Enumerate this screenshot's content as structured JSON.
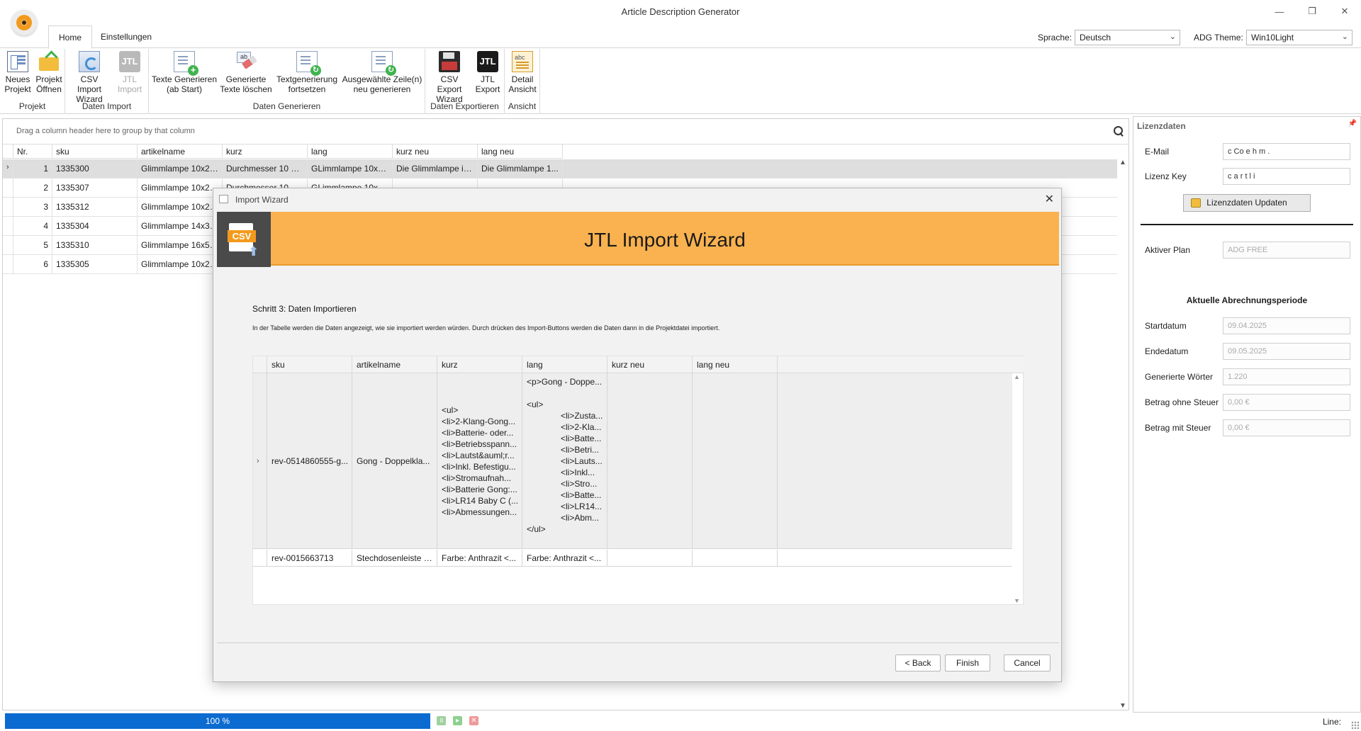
{
  "window": {
    "title": "Article Description Generator",
    "minimize": "—",
    "maximize": "❐",
    "close": "✕"
  },
  "ribbon_tabs": [
    "Home",
    "Einstellungen"
  ],
  "language": {
    "label": "Sprache:",
    "value": "Deutsch"
  },
  "theme": {
    "label": "ADG Theme:",
    "value": "Win10Light"
  },
  "ribbon": {
    "groups": {
      "projekt": "Projekt",
      "daten_import": "Daten Import",
      "daten_generieren": "Daten Generieren",
      "daten_exportieren": "Daten Exportieren",
      "ansicht": "Ansicht"
    },
    "buttons": {
      "neues_projekt": "Neues\nProjekt",
      "projekt_oeffnen": "Projekt\nÖffnen",
      "csv_import_wizard": "CSV Import\nWizard",
      "jtl_import": "JTL\nImport",
      "texte_generieren": "Texte Generieren\n(ab Start)",
      "generierte_texte_loeschen": "Generierte\nTexte löschen",
      "textgenerierung_fortsetzen": "Textgenerierung\nfortsetzen",
      "ausgewaehlte_neu_generieren": "Ausgewählte Zeile(n)\nneu generieren",
      "csv_export_wizard": "CSV Export\nWizard",
      "jtl_export": "JTL\nExport",
      "detail_ansicht": "Detail\nAnsicht"
    },
    "jtl_glyph": "JTL"
  },
  "grid": {
    "group_hint": "Drag a column header here to group by that column",
    "columns": [
      "Nr.",
      "sku",
      "artikelname",
      "kurz",
      "lang",
      "kurz neu",
      "lang neu"
    ],
    "rows": [
      {
        "nr": "1",
        "sku": "1335300",
        "artikelname": "Glimmlampe 10x25...",
        "kurz": "Durchmesser 10 m...",
        "lang": "GLimmlampe 10x2...",
        "kurz_neu": "Die Glimmlampe in...",
        "lang_neu": "Die Glimmlampe 1..."
      },
      {
        "nr": "2",
        "sku": "1335307",
        "artikelname": "Glimmlampe 10x28...",
        "kurz": "Durchmesser 10 m...",
        "lang": "GLimmlampe 10x2...",
        "kurz_neu": "",
        "lang_neu": ""
      },
      {
        "nr": "3",
        "sku": "1335312",
        "artikelname": "Glimmlampe 10x28...",
        "kurz": "",
        "lang": "",
        "kurz_neu": "",
        "lang_neu": ""
      },
      {
        "nr": "4",
        "sku": "1335304",
        "artikelname": "Glimmlampe 14x32...",
        "kurz": "",
        "lang": "",
        "kurz_neu": "",
        "lang_neu": ""
      },
      {
        "nr": "5",
        "sku": "1335310",
        "artikelname": "Glimmlampe 16x54...",
        "kurz": "",
        "lang": "",
        "kurz_neu": "",
        "lang_neu": ""
      },
      {
        "nr": "6",
        "sku": "1335305",
        "artikelname": "Glimmlampe 10x25...",
        "kurz": "",
        "lang": "",
        "kurz_neu": "",
        "lang_neu": ""
      }
    ]
  },
  "license": {
    "title": "Lizenzdaten",
    "pin": "📌",
    "email_label": "E-Mail",
    "email_value": "c Co  e  h m      .",
    "key_label": "Lizenz Key",
    "key_value": "c a  r   t         l i",
    "update_button": "Lizenzdaten Updaten",
    "plan_label": "Aktiver Plan",
    "plan_value": "ADG FREE",
    "period_heading": "Aktuelle Abrechnungsperiode",
    "start_label": "Startdatum",
    "start_value": "09.04.2025",
    "end_label": "Endedatum",
    "end_value": "09.05.2025",
    "words_label": "Generierte Wörter",
    "words_value": "1.220",
    "net_label": "Betrag ohne Steuer",
    "net_value": "0,00 €",
    "gross_label": "Betrag mit Steuer",
    "gross_value": "0,00 €"
  },
  "status": {
    "progress_text": "100 %",
    "progress": 1.0,
    "line_label": "Line:"
  },
  "dialog": {
    "title": "Import Wizard",
    "banner_title": "JTL Import Wizard",
    "csv_tag": "CSV",
    "step_title": "Schritt 3: Daten Importieren",
    "step_desc": "In der Tabelle werden die Daten angezeigt, wie sie importiert werden würden. Durch drücken des Import-Buttons werden die Daten dann in die Projektdatei importiert.",
    "columns": [
      "sku",
      "artikelname",
      "kurz",
      "lang",
      "kurz neu",
      "lang neu"
    ],
    "row1": {
      "sku": "rev-0514860555-g...",
      "artikelname": "Gong - Doppelkla...",
      "kurz_lines": [
        "<ul>",
        "<li>2-Klang-Gong...",
        "<li>Batterie- oder...",
        "<li>Betriebsspann...",
        "<li>Lautst&auml;r...",
        "<li>Inkl. Befestigu...",
        "<li>Stromaufnah...",
        "<li>Batterie Gong:...",
        "<li>LR14 Baby C (...",
        "<li>Abmessungen..."
      ],
      "lang_head": "<p>Gong - Doppe...",
      "lang_ul": "<ul>",
      "lang_items": [
        "<li>Zusta...",
        "<li>2-Kla...",
        "<li>Batte...",
        "<li>Betri...",
        "<li>Lauts...",
        "<li>Inkl...",
        "<li>Stro...",
        "<li>Batte...",
        "<li>LR14...",
        "<li>Abm..."
      ],
      "lang_end": "</ul>"
    },
    "row2": {
      "sku": "rev-0015663713",
      "artikelname": "Stechdosenleiste S...",
      "kurz": "Farbe: Anthrazit <...",
      "lang": "Farbe: Anthrazit <..."
    },
    "back": "< Back",
    "finish": "Finish",
    "cancel": "Cancel",
    "close": "✕"
  }
}
